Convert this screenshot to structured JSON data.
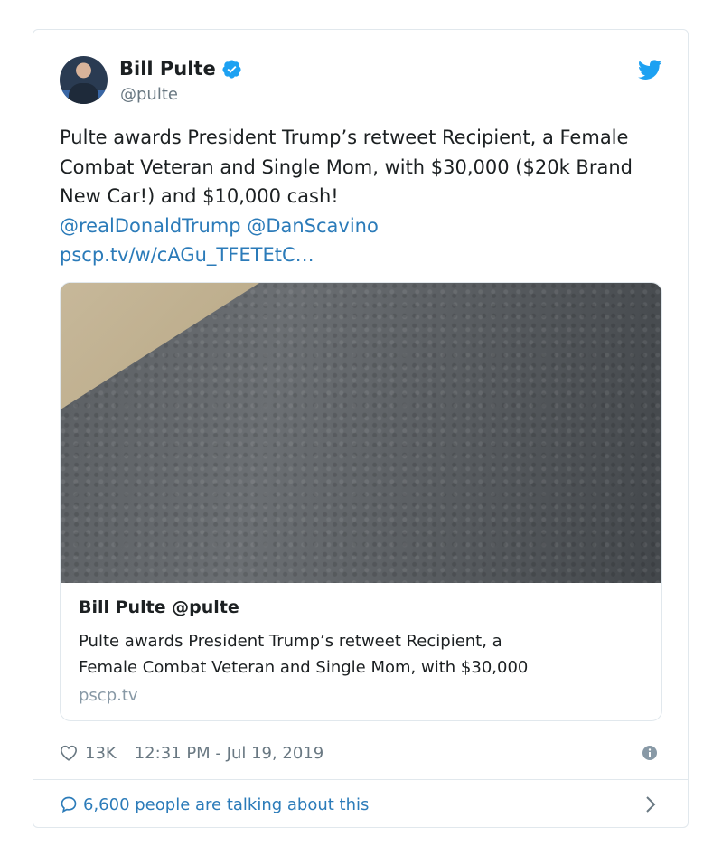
{
  "tweet": {
    "author": {
      "display_name": "Bill Pulte",
      "handle": "@pulte"
    },
    "text_plain": "Pulte awards President Trump’s retweet Recipient, a Female Combat Veteran and Single Mom, with $30,000 ($20k Brand New Car!) and $10,000 cash!",
    "mentions": [
      "@realDonaldTrump",
      "@DanScavino"
    ],
    "link": "pscp.tv/w/cAGu_TFETEtC…",
    "card": {
      "title": "Bill Pulte @pulte",
      "description_line1": "Pulte awards President Trump’s retweet Recipient, a",
      "description_line2": "Female Combat Veteran and Single Mom, with $30,000",
      "domain": "pscp.tv"
    },
    "likes": "13K",
    "timestamp": "12:31 PM - Jul 19, 2019",
    "talking": "6,600 people are talking about this"
  },
  "colors": {
    "link": "#2b7bb9",
    "verified": "#1da1f2",
    "muted": "#697882",
    "border": "#e1e8ed"
  },
  "icons": [
    "verified-badge-icon",
    "twitter-bird-icon",
    "heart-icon",
    "info-icon",
    "speech-bubble-icon",
    "chevron-right-icon"
  ]
}
